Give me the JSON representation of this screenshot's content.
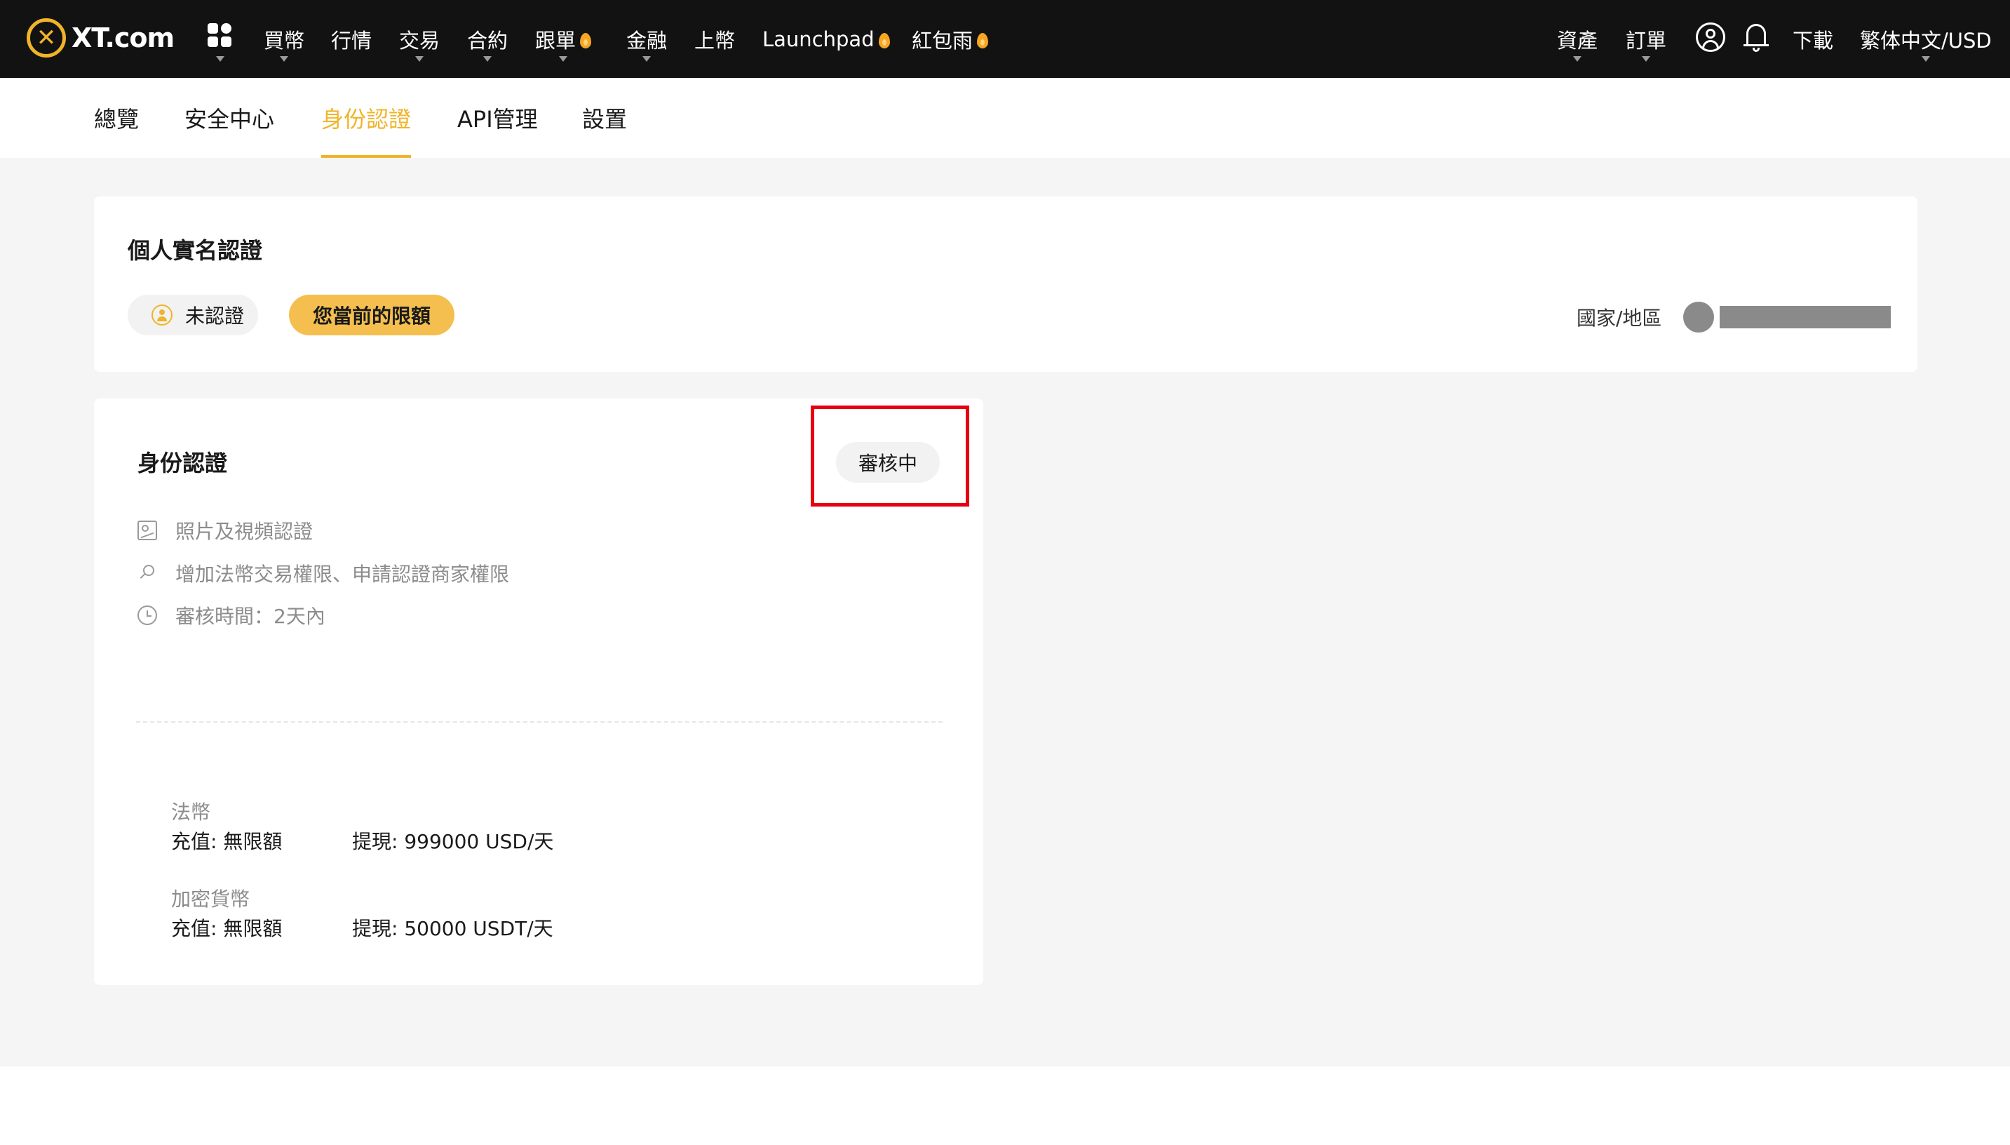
{
  "header": {
    "logo_text": "XT.com",
    "nav": [
      {
        "label": "買幣",
        "has_caret": true,
        "hot": false
      },
      {
        "label": "行情",
        "has_caret": false,
        "hot": false
      },
      {
        "label": "交易",
        "has_caret": true,
        "hot": false
      },
      {
        "label": "合約",
        "has_caret": true,
        "hot": false
      },
      {
        "label": "跟單",
        "has_caret": true,
        "hot": true
      },
      {
        "label": "金融",
        "has_caret": true,
        "hot": false
      },
      {
        "label": "上幣",
        "has_caret": false,
        "hot": false
      },
      {
        "label": "Launchpad",
        "has_caret": false,
        "hot": true
      },
      {
        "label": "紅包雨",
        "has_caret": false,
        "hot": true
      }
    ],
    "right": {
      "assets": "資產",
      "orders": "訂單",
      "download": "下載",
      "language": "繁体中文/USD"
    }
  },
  "subnav": {
    "tabs": [
      {
        "label": "總覽",
        "active": false
      },
      {
        "label": "安全中心",
        "active": false
      },
      {
        "label": "身份認證",
        "active": true
      },
      {
        "label": "API管理",
        "active": false
      },
      {
        "label": "設置",
        "active": false
      }
    ]
  },
  "kyc_summary": {
    "title": "個人實名認證",
    "status_pill": "未認證",
    "limit_button": "您當前的限額",
    "country_label": "國家/地區"
  },
  "identity_card": {
    "title": "身份認證",
    "status": "審核中",
    "features": [
      {
        "icon": "image-icon",
        "text": "照片及視頻認證"
      },
      {
        "icon": "search-icon",
        "text": "增加法幣交易權限、申請認證商家權限"
      },
      {
        "icon": "clock-icon",
        "text": "審核時間：2天內"
      }
    ],
    "limits": {
      "fiat": {
        "label": "法幣",
        "deposit": "充值: 無限額",
        "withdraw": "提現: 999000 USD/天"
      },
      "crypto": {
        "label": "加密貨幣",
        "deposit": "充值: 無限額",
        "withdraw": "提現: 50000 USDT/天"
      }
    }
  },
  "colors": {
    "accent": "#f0b429",
    "header_bg": "#121212",
    "highlight": "#e60012"
  }
}
